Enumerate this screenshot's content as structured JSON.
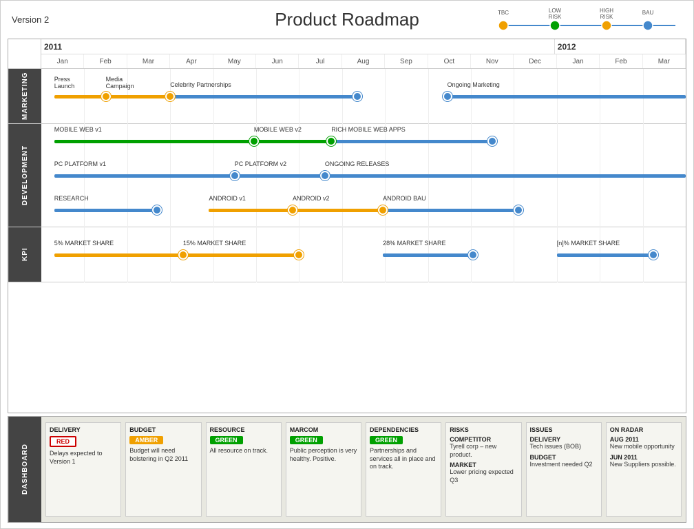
{
  "header": {
    "version": "Version 2",
    "title": "Product Roadmap",
    "legend": [
      {
        "label": "TBC",
        "color": "#f0a000",
        "line_color": "#f0a000"
      },
      {
        "label": "LOW RISK",
        "color": "#00a000",
        "line_color": "#00a000"
      },
      {
        "label": "HIGH RISK",
        "color": "#f0a000",
        "line_color": "#f0a000"
      },
      {
        "label": "BAU",
        "color": "#4488cc",
        "line_color": "#4488cc"
      }
    ]
  },
  "timeline": {
    "years": [
      {
        "label": "2011",
        "span": 12
      },
      {
        "label": "2012",
        "span": 3
      }
    ],
    "months": [
      "Jan",
      "Feb",
      "Mar",
      "Apr",
      "May",
      "Jun",
      "Jul",
      "Aug",
      "Sep",
      "Oct",
      "Nov",
      "Dec",
      "Jan",
      "Feb",
      "Mar"
    ]
  },
  "swimlanes": [
    {
      "id": "marketing",
      "label": "MARKETING",
      "rows": [
        {
          "bars": [
            {
              "label": "Press\nLaunch",
              "start_pct": 2,
              "end_pct": 10,
              "color": "#f0a000",
              "label_top": true
            },
            {
              "label": "Media\nCampaign",
              "start_pct": 10,
              "end_pct": 20,
              "color": "#f0a000",
              "label_top": false
            },
            {
              "label": "Celebrity Partnerships",
              "start_pct": 20,
              "end_pct": 49,
              "color": "#4488cc",
              "label_top": false
            },
            {
              "label": "Ongoing Marketing",
              "start_pct": 63,
              "end_pct": 100,
              "color": "#4488cc",
              "label_top": false
            }
          ],
          "nodes": [
            {
              "pct": 10,
              "color": "#f0a000"
            },
            {
              "pct": 20,
              "color": "#f0a000"
            },
            {
              "pct": 49,
              "color": "#4488cc"
            },
            {
              "pct": 63,
              "color": "#4488cc"
            }
          ]
        }
      ]
    },
    {
      "id": "development",
      "label": "DEVELOPMENT",
      "rows": [
        {
          "bars": [
            {
              "label": "MOBILE WEB v1",
              "start_pct": 2,
              "end_pct": 33,
              "color": "#00a000"
            },
            {
              "label": "MOBILE WEB v2",
              "start_pct": 33,
              "end_pct": 45,
              "color": "#00a000"
            },
            {
              "label": "RICH MOBILE WEB APPS",
              "start_pct": 45,
              "end_pct": 70,
              "color": "#4488cc"
            }
          ],
          "nodes": [
            {
              "pct": 33,
              "color": "#00a000"
            },
            {
              "pct": 45,
              "color": "#00a000"
            },
            {
              "pct": 70,
              "color": "#4488cc"
            }
          ]
        },
        {
          "bars": [
            {
              "label": "PC PLATFORM v1",
              "start_pct": 2,
              "end_pct": 30,
              "color": "#4488cc"
            },
            {
              "label": "PC PLATFORM v2",
              "start_pct": 30,
              "end_pct": 44,
              "color": "#4488cc"
            },
            {
              "label": "ONGOING RELEASES",
              "start_pct": 44,
              "end_pct": 100,
              "color": "#4488cc"
            }
          ],
          "nodes": [
            {
              "pct": 30,
              "color": "#4488cc"
            },
            {
              "pct": 44,
              "color": "#4488cc"
            }
          ]
        },
        {
          "bars": [
            {
              "label": "RESEARCH",
              "start_pct": 2,
              "end_pct": 18,
              "color": "#4488cc"
            },
            {
              "label": "ANDROID v1",
              "start_pct": 26,
              "end_pct": 39,
              "color": "#f0a000"
            },
            {
              "label": "ANDROID v2",
              "start_pct": 39,
              "end_pct": 53,
              "color": "#f0a000"
            },
            {
              "label": "ANDROID BAU",
              "start_pct": 53,
              "end_pct": 74,
              "color": "#4488cc"
            }
          ],
          "nodes": [
            {
              "pct": 18,
              "color": "#4488cc"
            },
            {
              "pct": 39,
              "color": "#f0a000"
            },
            {
              "pct": 53,
              "color": "#f0a000"
            },
            {
              "pct": 74,
              "color": "#4488cc"
            }
          ]
        }
      ]
    },
    {
      "id": "kpi",
      "label": "KPI",
      "rows": [
        {
          "bars": [
            {
              "label": "5% MARKET SHARE",
              "start_pct": 2,
              "end_pct": 22,
              "color": "#f0a000"
            },
            {
              "label": "15% MARKET SHARE",
              "start_pct": 22,
              "end_pct": 40,
              "color": "#f0a000"
            },
            {
              "label": "28% MARKET SHARE",
              "start_pct": 53,
              "end_pct": 67,
              "color": "#4488cc"
            },
            {
              "label": "[n]% MARKET SHARE",
              "start_pct": 80,
              "end_pct": 95,
              "color": "#4488cc"
            }
          ],
          "nodes": [
            {
              "pct": 22,
              "color": "#f0a000"
            },
            {
              "pct": 40,
              "color": "#f0a000"
            },
            {
              "pct": 67,
              "color": "#4488cc"
            },
            {
              "pct": 95,
              "color": "#4488cc"
            }
          ]
        }
      ]
    }
  ],
  "dashboard": {
    "label": "DASHBOARD",
    "cards": [
      {
        "id": "delivery",
        "title": "DELIVERY",
        "badge": "RED",
        "badge_type": "red",
        "text": "Delays expected to Version 1"
      },
      {
        "id": "budget",
        "title": "BUDGET",
        "badge": "AMBER",
        "badge_type": "amber",
        "text": "Budget will need bolstering in Q2 2011"
      },
      {
        "id": "resource",
        "title": "RESOURCE",
        "badge": "GREEN",
        "badge_type": "green",
        "text": "All resource on track."
      },
      {
        "id": "marcom",
        "title": "MARCOM",
        "badge": "GREEN",
        "badge_type": "green",
        "text": "Public perception is very healthy. Positive."
      },
      {
        "id": "dependencies",
        "title": "DEPENDENCIES",
        "badge": "GREEN",
        "badge_type": "green",
        "text": "Partnerships and services all in place and on track."
      },
      {
        "id": "risks",
        "title": "RISKS",
        "subitems": [
          {
            "title": "COMPETITOR",
            "text": "Tyrell corp – new product."
          },
          {
            "title": "MARKET",
            "text": "Lower pricing expected Q3"
          }
        ]
      },
      {
        "id": "issues",
        "title": "ISSUES",
        "subitems": [
          {
            "title": "DELIVERY",
            "text": "Tech issues (BOB)"
          },
          {
            "title": "BUDGET",
            "text": "Investment needed Q2"
          }
        ]
      },
      {
        "id": "on-radar",
        "title": "ON RADAR",
        "subitems": [
          {
            "title": "AUG 2011",
            "text": "New mobile opportunity"
          },
          {
            "title": "JUN 2011",
            "text": "New Suppliers possible."
          }
        ]
      }
    ]
  }
}
